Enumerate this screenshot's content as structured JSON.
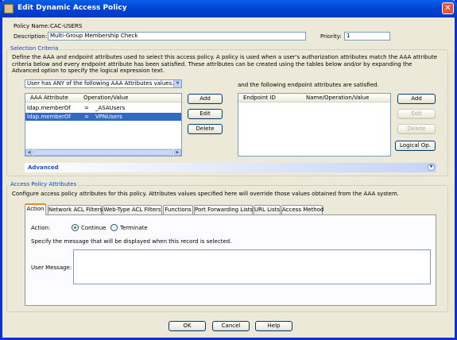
{
  "window": {
    "title": "Edit Dynamic Access Policy",
    "close_glyph": "✕"
  },
  "policy": {
    "name_label": "Policy Name:",
    "name_value": "CAC-USERS",
    "description_label": "Description:",
    "description_value": "Multi-Group Membership Check",
    "priority_label": "Priority:",
    "priority_value": "1"
  },
  "selection_criteria": {
    "title": "Selection Criteria",
    "description": "Define the AAA and endpoint attributes used to select this access policy. A policy is used when a user's authorization attributes match the AAA attribute criteria below and every endpoint attribute has been satisfied. These attributes can be created using the tables below and/or by expanding the Advanced option to specify the logical expression text.",
    "aaa_match_selected": "User has ANY of the following AAA Attributes values...",
    "aaa_table": {
      "columns": [
        "AAA Attribute",
        "Operation/Value"
      ],
      "rows": [
        {
          "attribute": "ldap.memberOf",
          "op": "=",
          "value": "_ASAUsers",
          "selected": false
        },
        {
          "attribute": "ldap.memberOf",
          "op": "=",
          "value": "VPNUsers",
          "selected": true
        }
      ]
    },
    "aaa_buttons": {
      "add": "Add",
      "edit": "Edit",
      "delete": "Delete"
    },
    "endpoint_label": "and the following endpoint attributes are satisfied.",
    "endpoint_table": {
      "columns": [
        "Endpoint ID",
        "Name/Operation/Value"
      ],
      "rows": []
    },
    "endpoint_buttons": {
      "add": "Add",
      "edit": "Edit",
      "delete": "Delete",
      "logical": "Logical Op."
    },
    "advanced_label": "Advanced"
  },
  "access_policy": {
    "title": "Access Policy Attributes",
    "description": "Configure access policy attributes for this policy. Attributes values specified here will override those values obtained from the AAA system.",
    "tabs": [
      "Action",
      "Network ACL Filters",
      "Web-Type ACL Filters",
      "Functions",
      "Port Forwarding Lists",
      "URL Lists",
      "Access Method"
    ],
    "active_tab": "Action",
    "action_label": "Action:",
    "action_options": [
      "Continue",
      "Terminate"
    ],
    "action_selected": "Continue",
    "message_instruction": "Specify the message that will be displayed when this record is selected.",
    "user_message_label": "User Message:",
    "user_message_value": ""
  },
  "footer": {
    "ok": "OK",
    "cancel": "Cancel",
    "help": "Help"
  },
  "colors": {
    "title_bar": "#0046d5",
    "selection": "#316ac5",
    "group_title": "#0046d5",
    "window_bg": "#ece9d8"
  }
}
